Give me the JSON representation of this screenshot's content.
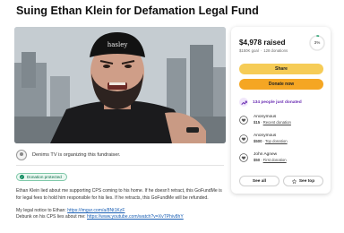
{
  "page": {
    "title": "Suing Ethan Klein for Defamation Legal Fund"
  },
  "hero": {
    "cap_text": "hasley"
  },
  "organizer": {
    "text": "Denims TV is organizing this fundraiser."
  },
  "badge": {
    "label": "Donation protected"
  },
  "story": {
    "para1": "Ethan Klein lied about me supporting CPS coming to his home. If he doesn't retract, this GoFundMe is for legal fees to hold him responsible for his lies. If he retracts, this GoFundMe will be refunded.",
    "notice_label": "My legal notice to Ethan:",
    "notice_link": "https://imgur.com/a/8Nt1KzF",
    "debunk_label": "Debunk on his CPS lies about me:",
    "debunk_link": "https://www.youtube.com/watch?v=XvTPhiv8hY"
  },
  "card": {
    "raised": "$4,978 raised",
    "goal": "$150K goal",
    "donations": "128 donations",
    "progress_pct": 3,
    "progress_label": "3%",
    "share_label": "Share",
    "donate_label": "Donate now",
    "trending": "134 people just donated",
    "donors": [
      {
        "name": "Anonymous",
        "amount": "$15",
        "tag": "Recent donation"
      },
      {
        "name": "Anonymous",
        "amount": "$500",
        "tag": "Top donation"
      },
      {
        "name": "John Agnew",
        "amount": "$50",
        "tag": "First donation"
      }
    ],
    "see_all": "See all",
    "see_top": "See top"
  },
  "colors": {
    "share": "#f6cc57",
    "donate": "#f5a623",
    "trending": "#6b2fb3",
    "protected": "#0f8a5f",
    "progress": "#1f9e6b"
  },
  "icons": {
    "trend": "trending-up-icon",
    "donor": "donor-heart-icon",
    "star": "star-icon",
    "check": "check-icon"
  }
}
